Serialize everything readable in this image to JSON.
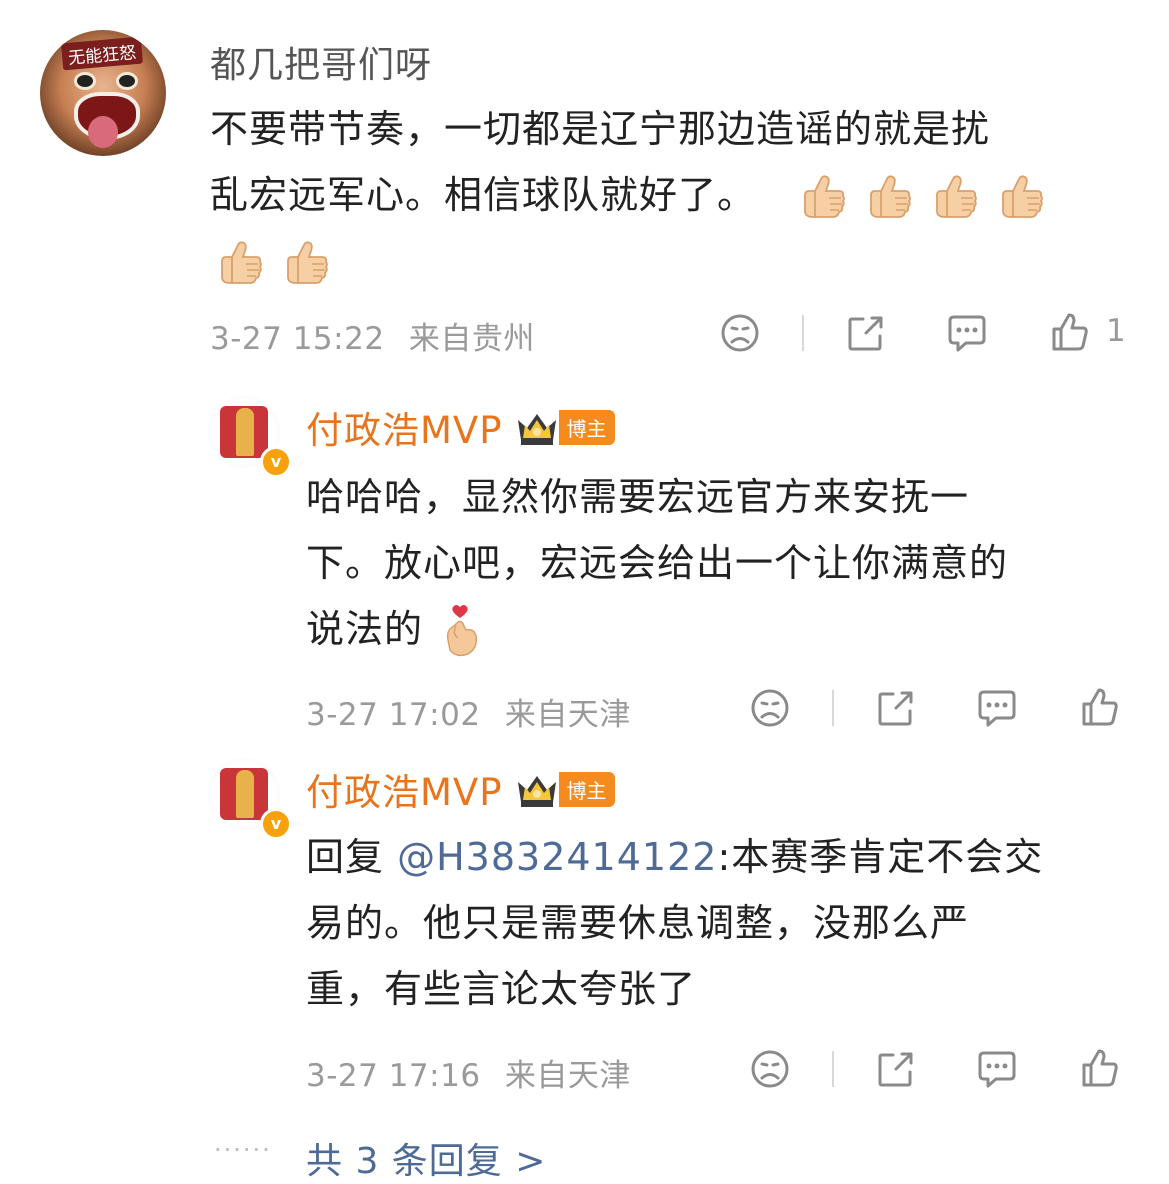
{
  "comment": {
    "username": "都几把哥们呀",
    "avatar_text": "无能狂怒",
    "text_line1": "不要带节奏，一切都是辽宁那边造谣的就是扰",
    "text_line2": "乱宏远军心。相信球队就好了。",
    "thumbs_count": 6,
    "time": "3-27 15:22",
    "location": "来自贵州",
    "like_count": "1"
  },
  "replies": [
    {
      "username": "付政浩MVP",
      "badge": "博主",
      "verified": "v",
      "text_line1": "哈哈哈，显然你需要宏远官方来安抚一",
      "text_line2": "下。放心吧，宏远会给出一个让你满意的",
      "text_line3": "说法的",
      "time": "3-27 17:02",
      "location": "来自天津"
    },
    {
      "username": "付政浩MVP",
      "badge": "博主",
      "verified": "v",
      "reply_prefix": "回复 ",
      "mention": "@H3832414122",
      "text_line1_rest": ":本赛季肯定不会交",
      "text_line2": "易的。他只是需要休息调整，没那么严",
      "text_line3": "重，有些言论太夸张了",
      "time": "3-27 17:16",
      "location": "来自天津"
    }
  ],
  "more_replies": {
    "dots": "······",
    "label": "共 3 条回复 >"
  },
  "colors": {
    "accent_orange": "#e8741b",
    "link_blue": "#4e6a96",
    "meta_gray": "#9a9a9a"
  }
}
